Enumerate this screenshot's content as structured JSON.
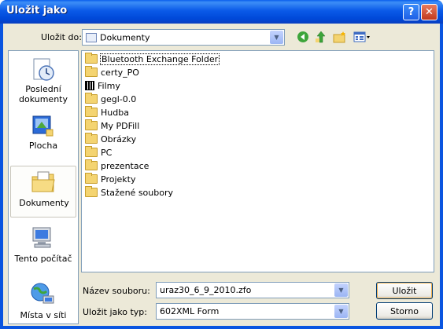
{
  "window": {
    "title": "Uložit jako",
    "help_glyph": "?",
    "close_glyph": "✕"
  },
  "save_in": {
    "label": "Uložit do:",
    "value": "Dokumenty"
  },
  "places": [
    {
      "label_line1": "Poslední",
      "label_line2": "dokumenty",
      "icon": "recent-documents-icon"
    },
    {
      "label_line1": "Plocha",
      "label_line2": "",
      "icon": "desktop-icon"
    },
    {
      "label_line1": "Dokumenty",
      "label_line2": "",
      "icon": "documents-icon"
    },
    {
      "label_line1": "Tento počítač",
      "label_line2": "",
      "icon": "computer-icon"
    },
    {
      "label_line1": "Místa v síti",
      "label_line2": "",
      "icon": "network-icon"
    }
  ],
  "files": [
    {
      "name": "Bluetooth Exchange Folder",
      "icon": "folder-icon"
    },
    {
      "name": "certy_PO",
      "icon": "folder-icon"
    },
    {
      "name": "Filmy",
      "icon": "film-folder-icon"
    },
    {
      "name": "gegl-0.0",
      "icon": "folder-icon"
    },
    {
      "name": "Hudba",
      "icon": "music-folder-icon"
    },
    {
      "name": "My PDFill",
      "icon": "folder-icon"
    },
    {
      "name": "Obrázky",
      "icon": "folder-icon"
    },
    {
      "name": "PC",
      "icon": "folder-icon"
    },
    {
      "name": "prezentace",
      "icon": "folder-icon"
    },
    {
      "name": "Projekty",
      "icon": "folder-icon"
    },
    {
      "name": "Stažené soubory",
      "icon": "folder-icon"
    }
  ],
  "filename": {
    "label": "Název souboru:",
    "value": "uraz30_6_9_2010.zfo"
  },
  "filetype": {
    "label": "Uložit jako typ:",
    "value": "602XML Form"
  },
  "buttons": {
    "save": "Uložit",
    "cancel": "Storno"
  },
  "colors": {
    "titlebar": "#0A55E0",
    "dialog_bg": "#ECE9D8",
    "border": "#7F9DB9"
  }
}
